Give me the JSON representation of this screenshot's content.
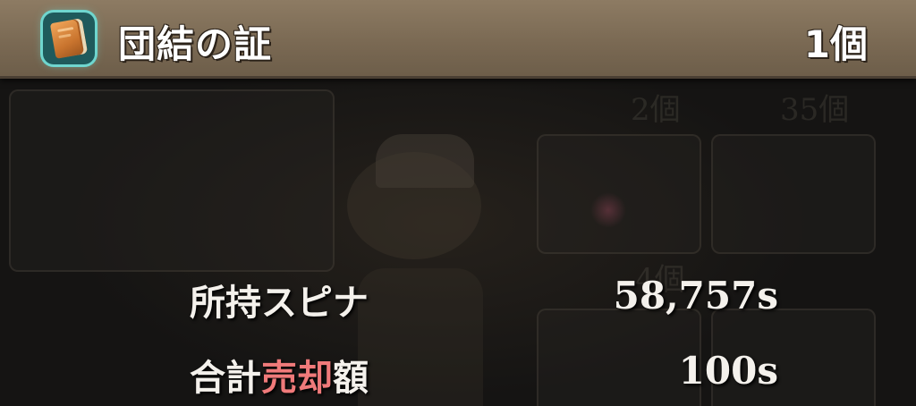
{
  "header": {
    "item_name": "団結の証",
    "item_count": "1個",
    "icon": "book-icon"
  },
  "stats": {
    "owned_spina_label": "所持スピナ",
    "owned_spina_value": "58,757s",
    "total_sale_label_prefix": "合計",
    "total_sale_label_accent": "売却",
    "total_sale_label_suffix": "額",
    "total_sale_value": "100s"
  },
  "background": {
    "faded_counts": [
      "2個",
      "35個",
      "4個"
    ]
  },
  "colors": {
    "header_bar": "#7a6953",
    "accent_red": "#f07a7a",
    "icon_glow": "#6fd6cf",
    "text": "#f4f1ec"
  }
}
